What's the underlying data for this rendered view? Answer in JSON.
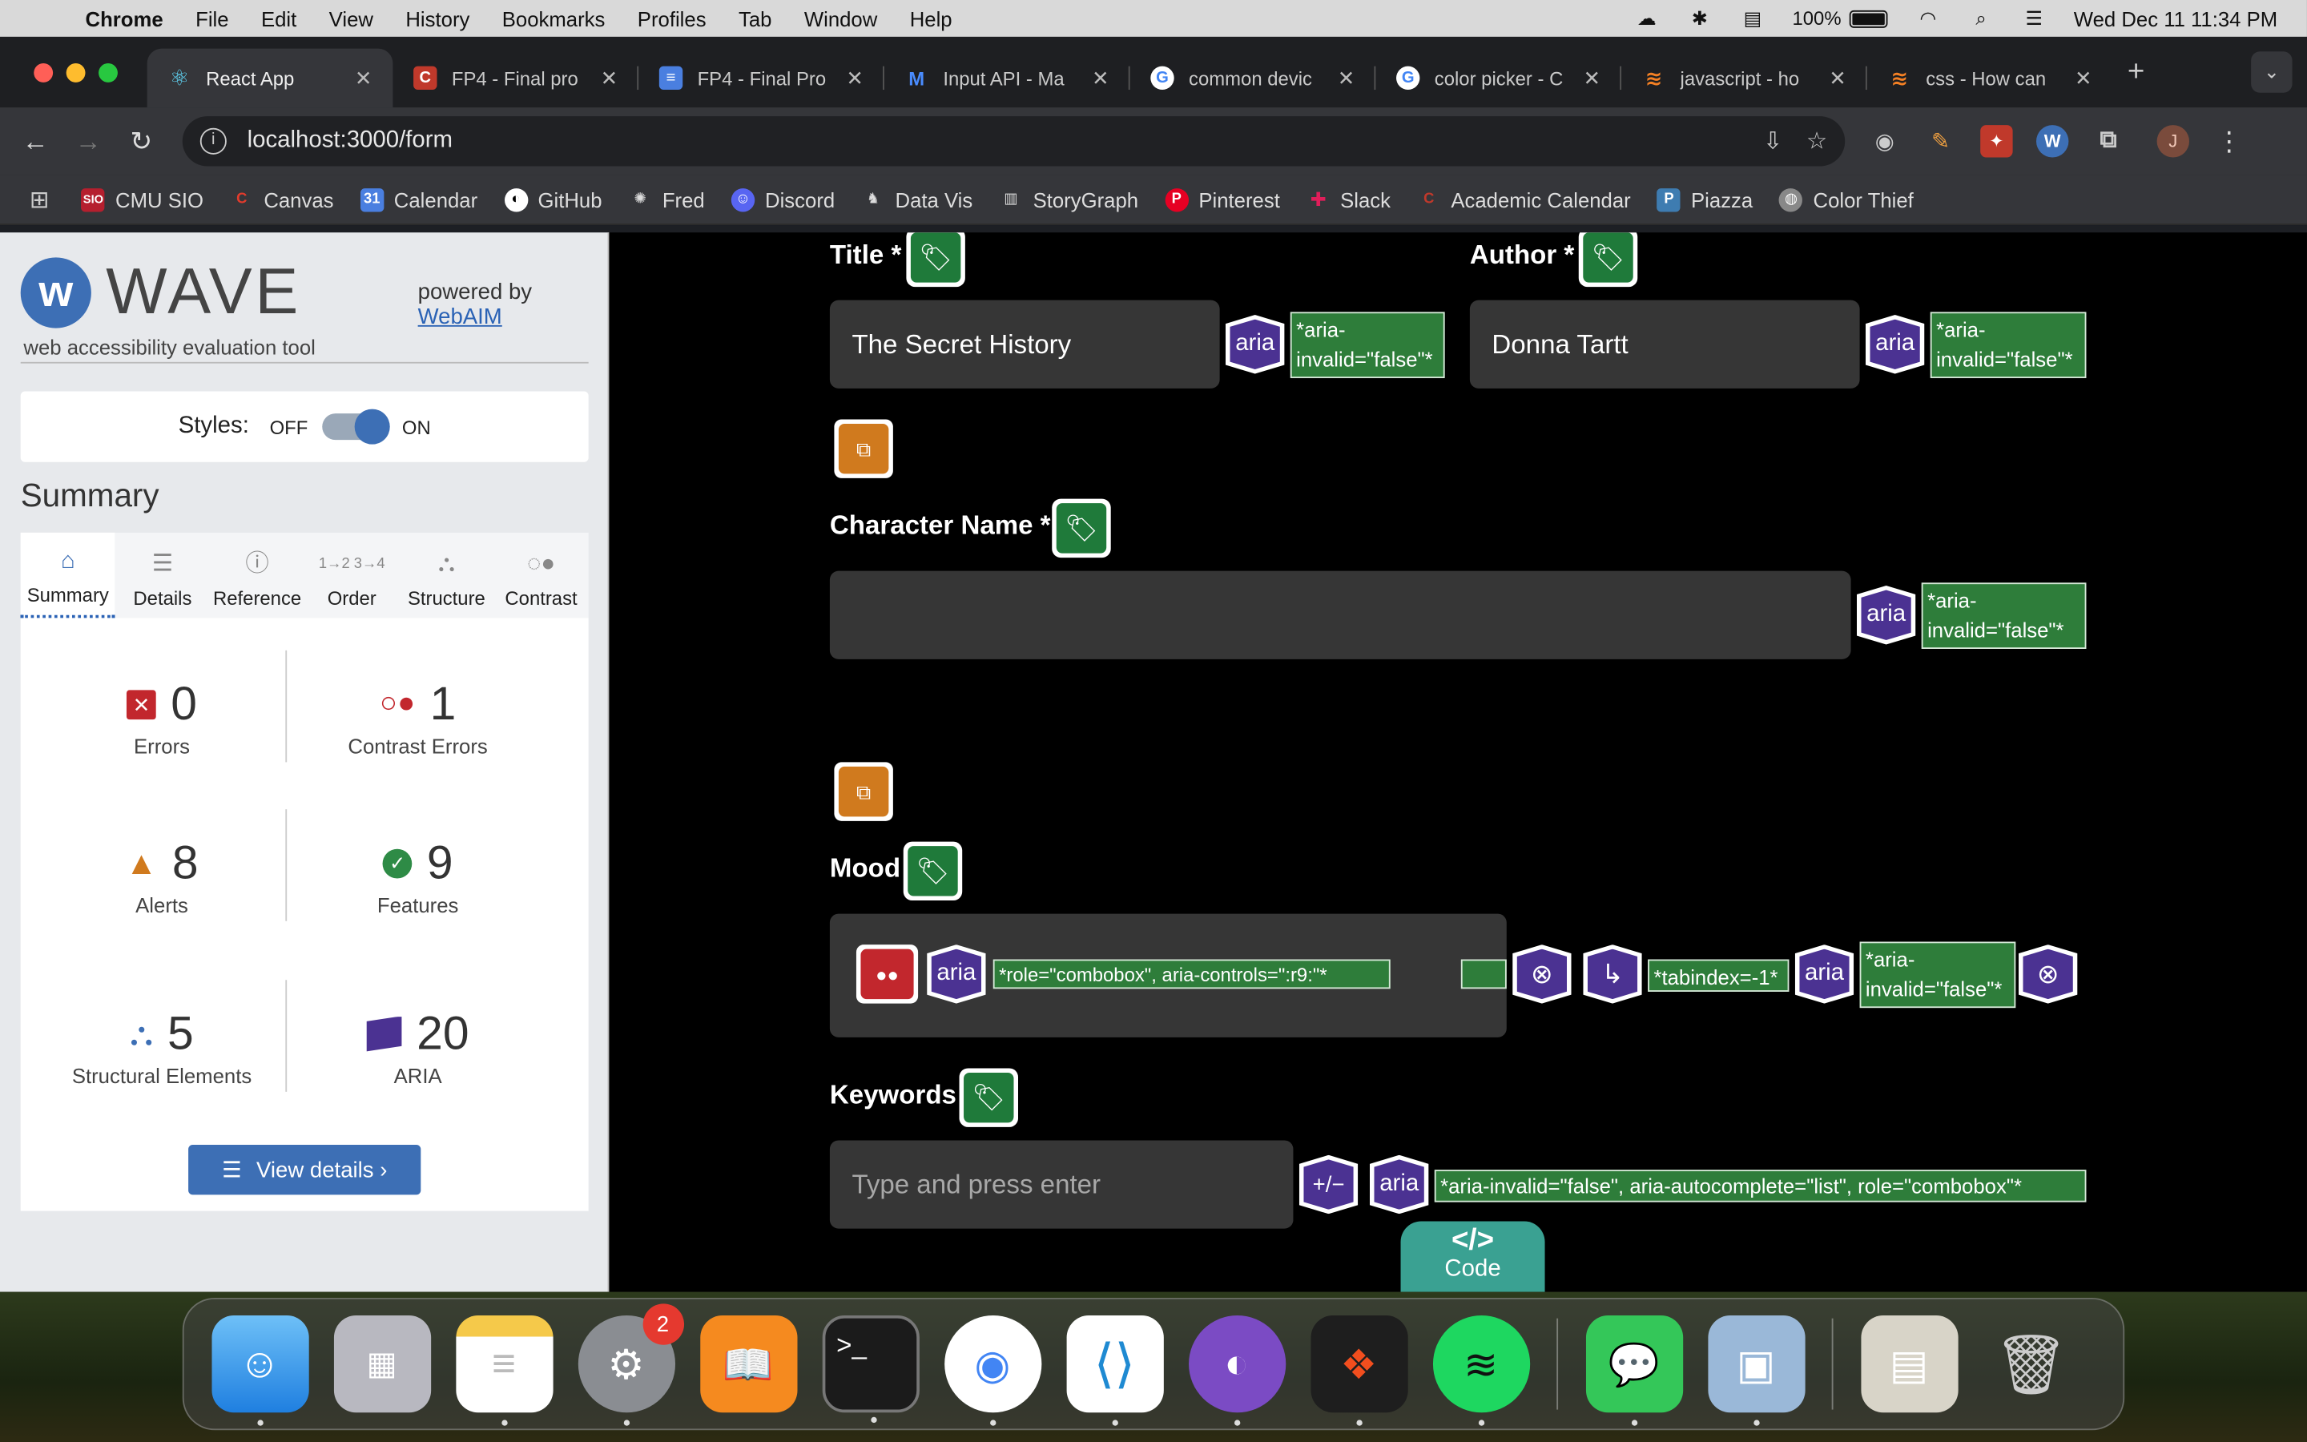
{
  "menubar": {
    "app": "Chrome",
    "items": [
      "File",
      "Edit",
      "View",
      "History",
      "Bookmarks",
      "Profiles",
      "Tab",
      "Window",
      "Help"
    ],
    "battery": "100%",
    "datetime": "Wed Dec 11  11:34 PM"
  },
  "tabs": [
    {
      "label": "React App",
      "active": true
    },
    {
      "label": "FP4 - Final pro"
    },
    {
      "label": "FP4 - Final Pro"
    },
    {
      "label": "Input API - Ma"
    },
    {
      "label": "common devic"
    },
    {
      "label": "color picker - C"
    },
    {
      "label": "javascript - ho"
    },
    {
      "label": "css - How can"
    }
  ],
  "address": {
    "url": "localhost:3000/form"
  },
  "bookmarks": [
    "CMU SIO",
    "Canvas",
    "Calendar",
    "GitHub",
    "Fred",
    "Discord",
    "Data Vis",
    "StoryGraph",
    "Pinterest",
    "Slack",
    "Academic Calendar",
    "Piazza",
    "Color Thief"
  ],
  "wave": {
    "logo": "WAVE",
    "subtitle": "web accessibility evaluation tool",
    "powered_by": "powered by",
    "webaim": "WebAIM",
    "styles_label": "Styles:",
    "styles_off": "OFF",
    "styles_on": "ON",
    "summary_title": "Summary",
    "tabs": [
      "Summary",
      "Details",
      "Reference",
      "Order",
      "Structure",
      "Contrast"
    ],
    "stats": {
      "errors": {
        "num": "0",
        "label": "Errors"
      },
      "contrast": {
        "num": "1",
        "label": "Contrast Errors"
      },
      "alerts": {
        "num": "8",
        "label": "Alerts"
      },
      "features": {
        "num": "9",
        "label": "Features"
      },
      "structure": {
        "num": "5",
        "label": "Structural Elements"
      },
      "aria": {
        "num": "20",
        "label": "ARIA"
      }
    },
    "view_details": "View details ›"
  },
  "form": {
    "title_label": "Title *",
    "title_value": "The Secret History",
    "author_label": "Author *",
    "author_value": "Donna Tartt",
    "character_label": "Character Name *",
    "mood_label": "Mood",
    "keywords_label": "Keywords",
    "keywords_placeholder": "Type and press enter",
    "aria_text": "aria",
    "aria_invalid": "*aria-invalid=\"false\"*",
    "combobox_note": "*role=\"combobox\", aria-controls=\":r9:\"*",
    "tabindex_note": "*tabindex=-1*",
    "keywords_note": "*aria-invalid=\"false\", aria-autocomplete=\"list\", role=\"combobox\"*",
    "plusminus": "+/−",
    "code_tab": "Code",
    "code_glyph": "</>"
  }
}
